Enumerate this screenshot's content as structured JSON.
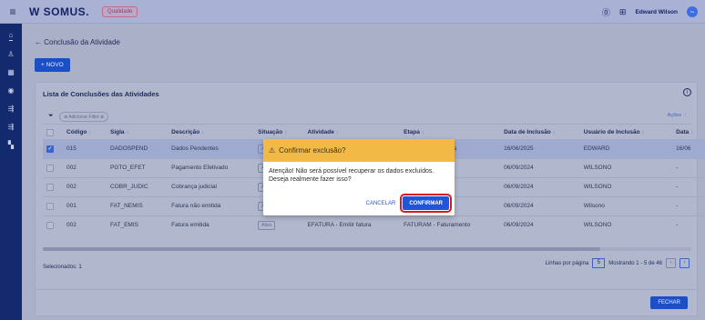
{
  "topbar": {
    "logo": "SOMUS.",
    "environment": "Qualidade",
    "help_icon": "?",
    "notifications_icon": "bell-icon",
    "user_name": "Edward Wilson",
    "avatar": "~"
  },
  "sidebar": {
    "items": [
      {
        "icon": "home-icon",
        "glyph": "⌂"
      },
      {
        "icon": "users-icon",
        "glyph": "♙"
      },
      {
        "icon": "grid-icon",
        "glyph": "▦"
      },
      {
        "icon": "circle-icon",
        "glyph": "◉"
      },
      {
        "icon": "flow-icon",
        "glyph": "⇶"
      },
      {
        "icon": "flow2-icon",
        "glyph": "⇶"
      },
      {
        "icon": "apps-icon",
        "glyph": "▚"
      }
    ]
  },
  "page": {
    "back_arrow": "←",
    "title": "Conclusão da Atividade",
    "new_button": "+ NOVO"
  },
  "card": {
    "title": "Lista de Conclusões das Atividades",
    "add_filter": "⊕ Adicionar Filtro ⊗",
    "actions": "Ações ⋮",
    "selected_label": "Selecionados: 1",
    "rows_per_page_label": "Linhas por página",
    "rows_per_page": "5",
    "range": "Mostrando 1 - 5 de 46"
  },
  "table": {
    "headers": [
      "Código",
      "Sigla",
      "Descrição",
      "Situação",
      "Atividade",
      "Etapa",
      "Data de Inclusão",
      "Usuário de Inclusão",
      "Data"
    ],
    "rows": [
      {
        "selected": true,
        "codigo": "015",
        "sigla": "DADOSPEND",
        "descricao": "Dados Pendentes",
        "situacao": "Ativo",
        "atividade": "",
        "etapa": "de dados cadastrais",
        "data": "16/06/2025",
        "usuario": "EDWARD",
        "data2": "16/06"
      },
      {
        "selected": false,
        "codigo": "002",
        "sigla": "PGTO_EFET",
        "descricao": "Pagamento Efetivado",
        "situacao": "Ativo",
        "atividade": "",
        "etapa": "lação",
        "data": "06/09/2024",
        "usuario": "WILSONO",
        "data2": "-"
      },
      {
        "selected": false,
        "codigo": "002",
        "sigla": "COBR_JUDIC",
        "descricao": "Cobrança judicial",
        "situacao": "Ativo",
        "atividade": "",
        "etapa": "de negociação",
        "data": "06/09/2024",
        "usuario": "WILSONO",
        "data2": "-"
      },
      {
        "selected": false,
        "codigo": "001",
        "sigla": "FAT_NEMIS",
        "descricao": "Fatura não emitida",
        "situacao": "Ativo",
        "atividade": "",
        "etapa": "mento",
        "data": "06/09/2024",
        "usuario": "Wilsono",
        "data2": "-"
      },
      {
        "selected": false,
        "codigo": "002",
        "sigla": "FAT_EMIS",
        "descricao": "Fatura emitida",
        "situacao": "Ativo",
        "atividade": "EFATURA - Emitir fatura",
        "etapa": "FATURAM - Faturamento",
        "data": "06/09/2024",
        "usuario": "WILSONO",
        "data2": "-"
      }
    ]
  },
  "footer": {
    "close_button": "FECHAR"
  },
  "dialog": {
    "title": "Confirmar exclusão?",
    "message_line1": "Atenção! Não será possível recuperar os dados excluídos.",
    "message_line2": "Deseja realmente fazer isso?",
    "cancel": "CANCELAR",
    "confirm": "CONFIRMAR"
  }
}
